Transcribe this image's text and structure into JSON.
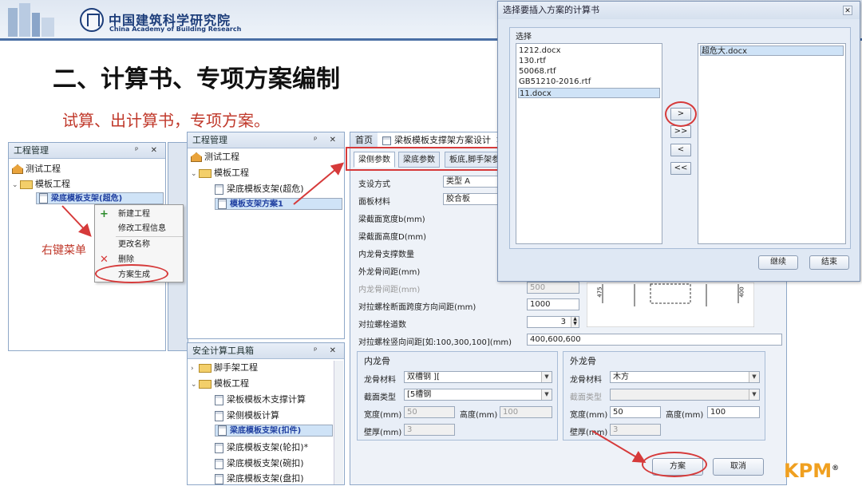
{
  "header": {
    "logo_cn": "中国建筑科学研究院",
    "logo_en": "China Academy of Building Research"
  },
  "slide": {
    "title": "二、计算书、专项方案编制",
    "subtitle": "试算、出计算书，专项方案。",
    "right_menu_label": "右键菜单"
  },
  "project_panel": {
    "title": "工程管理",
    "controls": "ᵖ ✕",
    "items": [
      "测试工程",
      "模板工程",
      "梁底模板支架(超危)"
    ]
  },
  "context_menu": {
    "items": [
      "新建工程",
      "修改工程信息",
      "更改名称",
      "删除",
      "方案生成"
    ]
  },
  "project_panel2": {
    "title": "工程管理",
    "controls": "ᵖ ✕",
    "items": [
      "测试工程",
      "模板工程",
      "梁底模板支架(超危)",
      "模板支架方案1"
    ]
  },
  "toolbox": {
    "title": "安全计算工具箱",
    "controls": "ᵖ ✕",
    "items": [
      "脚手架工程",
      "模板工程",
      "梁板模板木支撑计算",
      "梁侧模板计算",
      "梁底模板支架(扣件)",
      "梁底模板支架(轮扣)*",
      "梁底模板支架(碗扣)",
      "梁底模板支架(盘扣)"
    ]
  },
  "form": {
    "tabs": [
      "首页",
      "梁板模板支撑架方案设计"
    ],
    "subtabs": [
      "梁侧参数",
      "梁底参数",
      "板底,脚手架参"
    ],
    "fields": {
      "support_method": "支设方式",
      "support_method_value": "类型 A",
      "panel_material": "面板材料",
      "panel_material_value": "胶合板",
      "beam_width": "梁截面宽度b(mm)",
      "beam_height": "梁截面高度D(mm)",
      "inner_count": "内龙骨支撑数量",
      "outer_spacing": "外龙骨间距(mm)",
      "inner_spacing": "内龙骨间距(mm)",
      "inner_spacing_value": "500",
      "bolt_spacing": "对拉螺栓断面跨度方向间距(mm)",
      "bolt_spacing_value": "1000",
      "bolt_count": "对拉螺栓道数",
      "bolt_count_value": "3",
      "bolt_vertical": "对拉螺栓竖向间距[如:100,300,100](mm)",
      "bolt_vertical_value": "400,600,600"
    },
    "inner": {
      "title": "内龙骨",
      "material_label": "龙骨材料",
      "material_value": "双槽钢 ][",
      "section_label": "截面类型",
      "section_value": "[5槽钢",
      "width_label": "宽度(mm)",
      "width_value": "50",
      "height_label": "高度(mm)",
      "height_value": "100",
      "wall_label": "壁厚(mm)",
      "wall_value": "3"
    },
    "outer": {
      "title": "外龙骨",
      "material_label": "龙骨材料",
      "material_value": "木方",
      "section_label": "截面类型",
      "width_label": "宽度(mm)",
      "width_value": "50",
      "height_label": "高度(mm)",
      "height_value": "100",
      "wall_label": "壁厚(mm)",
      "wall_value": "3"
    },
    "plan_button": "方案",
    "cancel_button": "取消",
    "diagram_labels": [
      "475",
      "400"
    ]
  },
  "dialog": {
    "title": "选择要插入方案的计算书",
    "group": "选择",
    "left_list": [
      "1212.docx",
      "130.rtf",
      "50068.rtf",
      "GB51210-2016.rtf",
      "11.docx"
    ],
    "right_list": [
      "超危大.docx"
    ],
    "move_buttons": [
      ">",
      ">>",
      "<",
      "<<"
    ],
    "continue_button": "继续",
    "finish_button": "结束",
    "close": "✕"
  },
  "brand": {
    "text": "KPM",
    "mark": "®"
  },
  "colors": {
    "accent_red": "#d63a3a",
    "header_blue": "#1c3d7a",
    "selection": "#cfe3f7"
  }
}
